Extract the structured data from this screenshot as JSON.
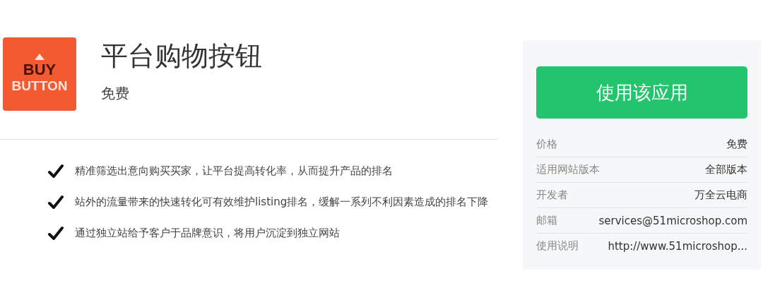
{
  "app": {
    "logo": {
      "line_1": "BUY",
      "line_2": "BUTTON"
    },
    "title": "平台购物按钮",
    "price": "免费"
  },
  "features": [
    {
      "text": "精准筛选出意向购买买家，让平台提高转化率，从而提升产品的排名"
    },
    {
      "text": "站外的流量带来的快速转化可有效维护listing排名，缓解一系列不利因素造成的排名下降"
    },
    {
      "text": "通过独立站给予客户于品牌意识，将用户沉淀到独立网站"
    }
  ],
  "sidebar": {
    "button": "使用该应用",
    "details": [
      {
        "label": "价格",
        "value": "免费"
      },
      {
        "label": "适用网站版本",
        "value": "全部版本"
      },
      {
        "label": "开发者",
        "value": "万全云电商"
      },
      {
        "label": "邮箱",
        "value": "services@51microshop.com"
      },
      {
        "label": "使用说明",
        "value": "http://www.51microshop..."
      }
    ]
  }
}
